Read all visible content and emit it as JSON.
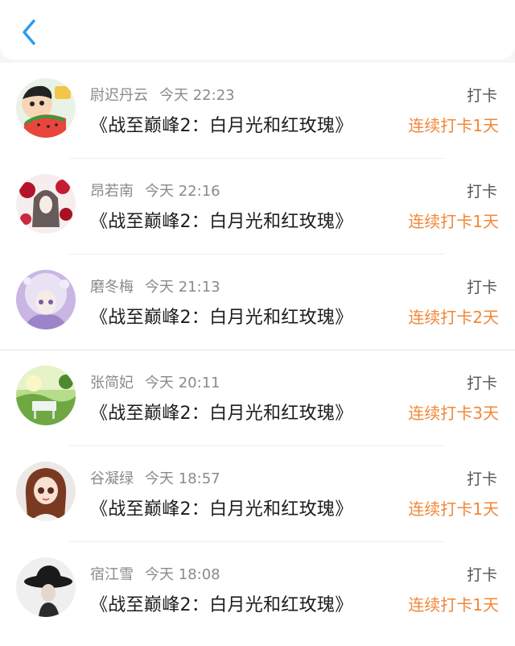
{
  "header": {
    "back_icon": "chevron-left-icon",
    "accent": "#2a9bf0"
  },
  "checkins": [
    {
      "user": "尉迟丹云",
      "time": "今天 22:23",
      "title": "《战至巅峰2：白月光和红玫瑰》",
      "action": "打卡",
      "streak": "连续打卡1天",
      "avatar": "cartoon-boy-avatar"
    },
    {
      "user": "昂若南",
      "time": "今天 22:16",
      "title": "《战至巅峰2：白月光和红玫瑰》",
      "action": "打卡",
      "streak": "连续打卡1天",
      "avatar": "red-flower-girl-avatar"
    },
    {
      "user": "磨冬梅",
      "time": "今天 21:13",
      "title": "《战至巅峰2：白月光和红玫瑰》",
      "action": "打卡",
      "streak": "连续打卡2天",
      "avatar": "purple-anime-girl-avatar"
    },
    {
      "user": "张简妃",
      "time": "今天 20:11",
      "title": "《战至巅峰2：白月光和红玫瑰》",
      "action": "打卡",
      "streak": "连续打卡3天",
      "avatar": "green-landscape-avatar"
    },
    {
      "user": "谷凝绿",
      "time": "今天 18:57",
      "title": "《战至巅峰2：白月光和红玫瑰》",
      "action": "打卡",
      "streak": "连续打卡1天",
      "avatar": "doll-avatar"
    },
    {
      "user": "宿江雪",
      "time": "今天 18:08",
      "title": "《战至巅峰2：白月光和红玫瑰》",
      "action": "打卡",
      "streak": "连续打卡1天",
      "avatar": "black-hat-woman-avatar"
    }
  ],
  "colors": {
    "streak": "#f0873a",
    "name": "#8a8a8a",
    "title": "#1c1c1c"
  }
}
